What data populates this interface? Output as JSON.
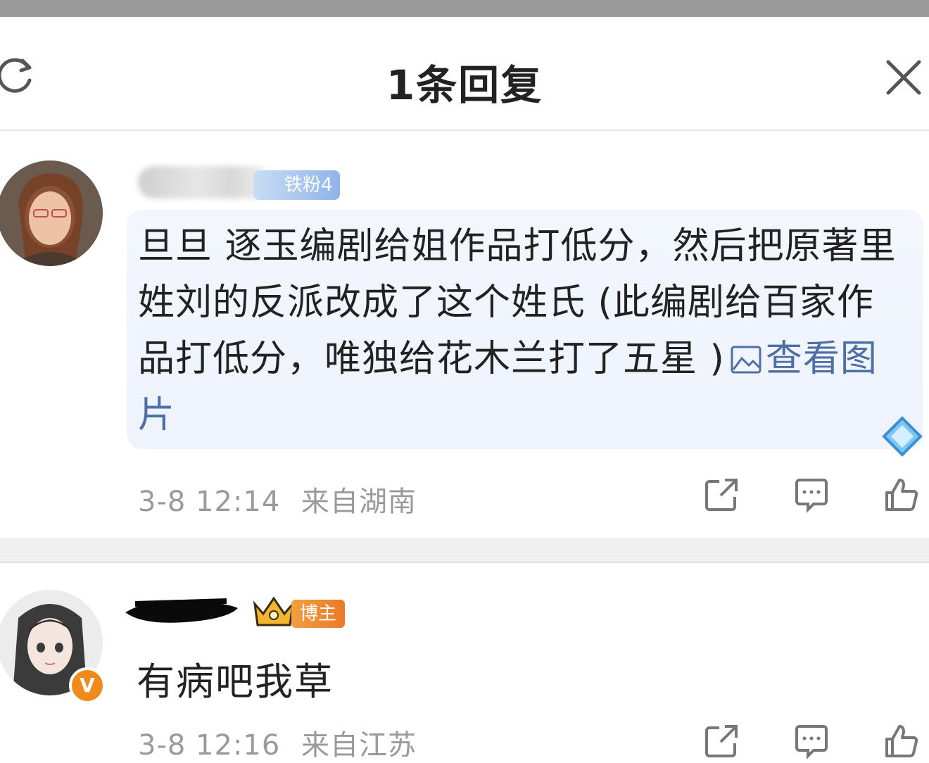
{
  "header": {
    "title": "1条回复",
    "refresh_icon": "refresh-icon",
    "close_icon": "close-icon"
  },
  "comments": [
    {
      "badge": "铁粉4",
      "text": "旦旦 逐玉编剧给姐作品打低分，然后把原著里姓刘的反派改成了这个姓氏 (此编剧给百家作品打低分，唯独给花木兰打了五星 )",
      "link": "查看图片",
      "time": "3-8 12:14",
      "location": "来自湖南"
    },
    {
      "badge": "博主",
      "text": "有病吧我草",
      "time": "3-8 12:16",
      "location": "来自江苏",
      "verified": "V"
    }
  ],
  "colors": {
    "link": "#4e6fa6",
    "fan_badge": "#8fb4ea",
    "blogger_badge": "#ea7a2a",
    "meta_text": "#9a9a9a"
  }
}
